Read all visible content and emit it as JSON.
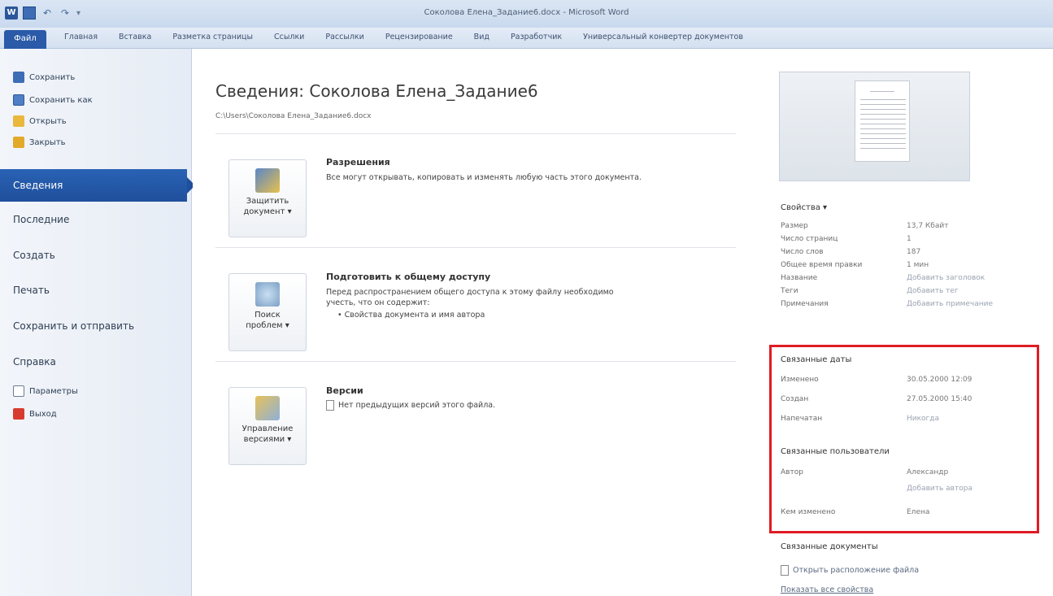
{
  "window": {
    "title": "Соколова Елена_Задание6.docx - Microsoft Word"
  },
  "ribbon": {
    "file_tab": "Файл",
    "tabs": [
      "Главная",
      "Вставка",
      "Разметка страницы",
      "Ссылки",
      "Рассылки",
      "Рецензирование",
      "Вид",
      "Разработчик",
      "Универсальный конвертер документов"
    ]
  },
  "backstage": {
    "commands": {
      "save": "Сохранить",
      "save_as": "Сохранить как",
      "open": "Открыть",
      "close": "Закрыть"
    },
    "nav": {
      "info": "Сведения",
      "recent": "Последние",
      "new": "Создать",
      "print": "Печать",
      "save_send": "Сохранить и отправить",
      "help": "Справка"
    },
    "footer_commands": {
      "options": "Параметры",
      "exit": "Выход"
    }
  },
  "info": {
    "title": "Сведения: Соколова Елена_Задание6",
    "path": "C:\\Users\\Соколова Елена_Задание6.docx",
    "permissions": {
      "button_line1": "Защитить",
      "button_line2": "документ ▾",
      "title": "Разрешения",
      "text": "Все могут открывать, копировать и изменять любую часть этого документа."
    },
    "prepare": {
      "button_line1": "Поиск",
      "button_line2": "проблем ▾",
      "title": "Подготовить к общему доступу",
      "text_line1": "Перед распространением общего доступа к этому файлу необходимо",
      "text_line2": "учесть, что он содержит:",
      "bullet": "Свойства документа и имя автора"
    },
    "versions": {
      "button_line1": "Управление",
      "button_line2": "версиями ▾",
      "title": "Версии",
      "text": "Нет предыдущих версий этого файла."
    }
  },
  "properties": {
    "header": "Свойства ▾",
    "rows": [
      {
        "key": "Размер",
        "value": "13,7 Кбайт"
      },
      {
        "key": "Число страниц",
        "value": "1"
      },
      {
        "key": "Число слов",
        "value": "187"
      },
      {
        "key": "Общее время правки",
        "value": "1 мин"
      },
      {
        "key": "Название",
        "value": "Добавить заголовок"
      },
      {
        "key": "Теги",
        "value": "Добавить тег"
      },
      {
        "key": "Примечания",
        "value": "Добавить примечание"
      }
    ],
    "dates_header": "Связанные даты",
    "dates": [
      {
        "key": "Изменено",
        "value": "30.05.2000 12:09"
      },
      {
        "key": "Создан",
        "value": "27.05.2000 15:40"
      },
      {
        "key": "Напечатан",
        "value": "Никогда"
      }
    ],
    "people_header": "Связанные пользователи",
    "author_key": "Автор",
    "author_value": "Александр",
    "add_author": "Добавить автора",
    "modified_by_key": "Кем изменено",
    "modified_by_value": "Елена",
    "docs_header": "Связанные документы",
    "open_location": "Открыть расположение файла",
    "show_all": "Показать все свойства"
  }
}
